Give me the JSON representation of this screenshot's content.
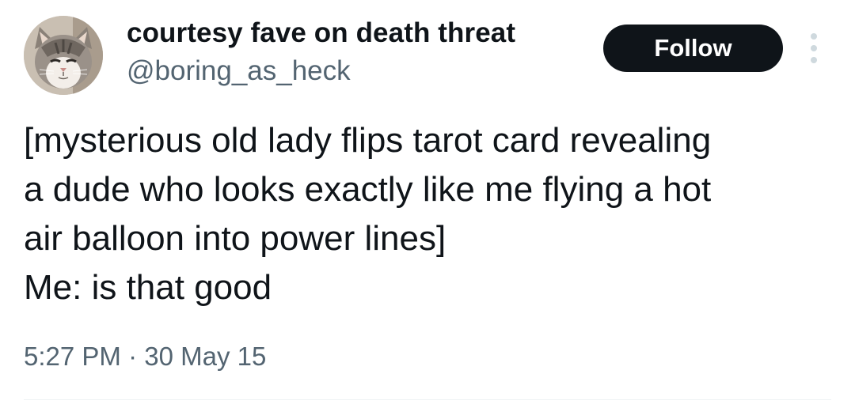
{
  "author": {
    "display_name": "courtesy fave on death threat",
    "handle": "@boring_as_heck",
    "avatar_icon": "cat-avatar-icon"
  },
  "actions": {
    "follow_label": "Follow",
    "more_icon": "more-vertical-icon"
  },
  "tweet": {
    "lines": [
      "[mysterious old lady flips tarot card revealing",
      "a dude who looks exactly like me flying a hot",
      "air balloon into power lines]",
      "Me: is that good"
    ],
    "timestamp": "5:27 PM · 30 May 15"
  },
  "colors": {
    "text_primary": "#0f1419",
    "text_secondary": "#536471",
    "follow_bg": "#0f1419",
    "follow_text": "#ffffff",
    "divider": "#eff3f4"
  }
}
